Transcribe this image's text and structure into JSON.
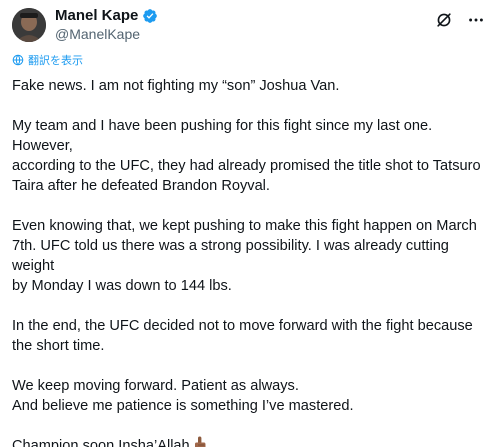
{
  "user": {
    "name": "Manel Kape",
    "handle": "@ManelKape"
  },
  "translate_label": "翻訳を表示",
  "post": {
    "p1": "Fake news. I am not fighting my “son” Joshua Van.",
    "p2_l1": "My team and I have been pushing for this fight since my last one. However,",
    "p2_l2": "according to the UFC, they had already promised the title shot to Tatsuro",
    "p2_l3": "Taira after he defeated Brandon Royval.",
    "p3_l1": "Even knowing that, we kept pushing to make this fight happen on March",
    "p3_l2": "7th. UFC told us there was a strong possibility. I was already cutting weight",
    "p3_l3": "by Monday I was down to 144 lbs.",
    "p4_l1": "In the end, the UFC decided not to move forward with the fight because",
    "p4_l2": "the short time.",
    "p5_l1": "We keep moving forward. Patient as always.",
    "p5_l2": "And believe me patience is something I’ve mastered.",
    "p6": "Champion soon Insha’Allah"
  },
  "colors": {
    "verified": "#1d9bf0",
    "link": "#1d9bf0",
    "secondary_text": "#536471"
  },
  "icons": {
    "verified": "verified-badge-icon",
    "grok": "grok-icon",
    "more": "more-icon",
    "translate": "translate-icon",
    "emoji": "finger-up-emoji-icon"
  }
}
